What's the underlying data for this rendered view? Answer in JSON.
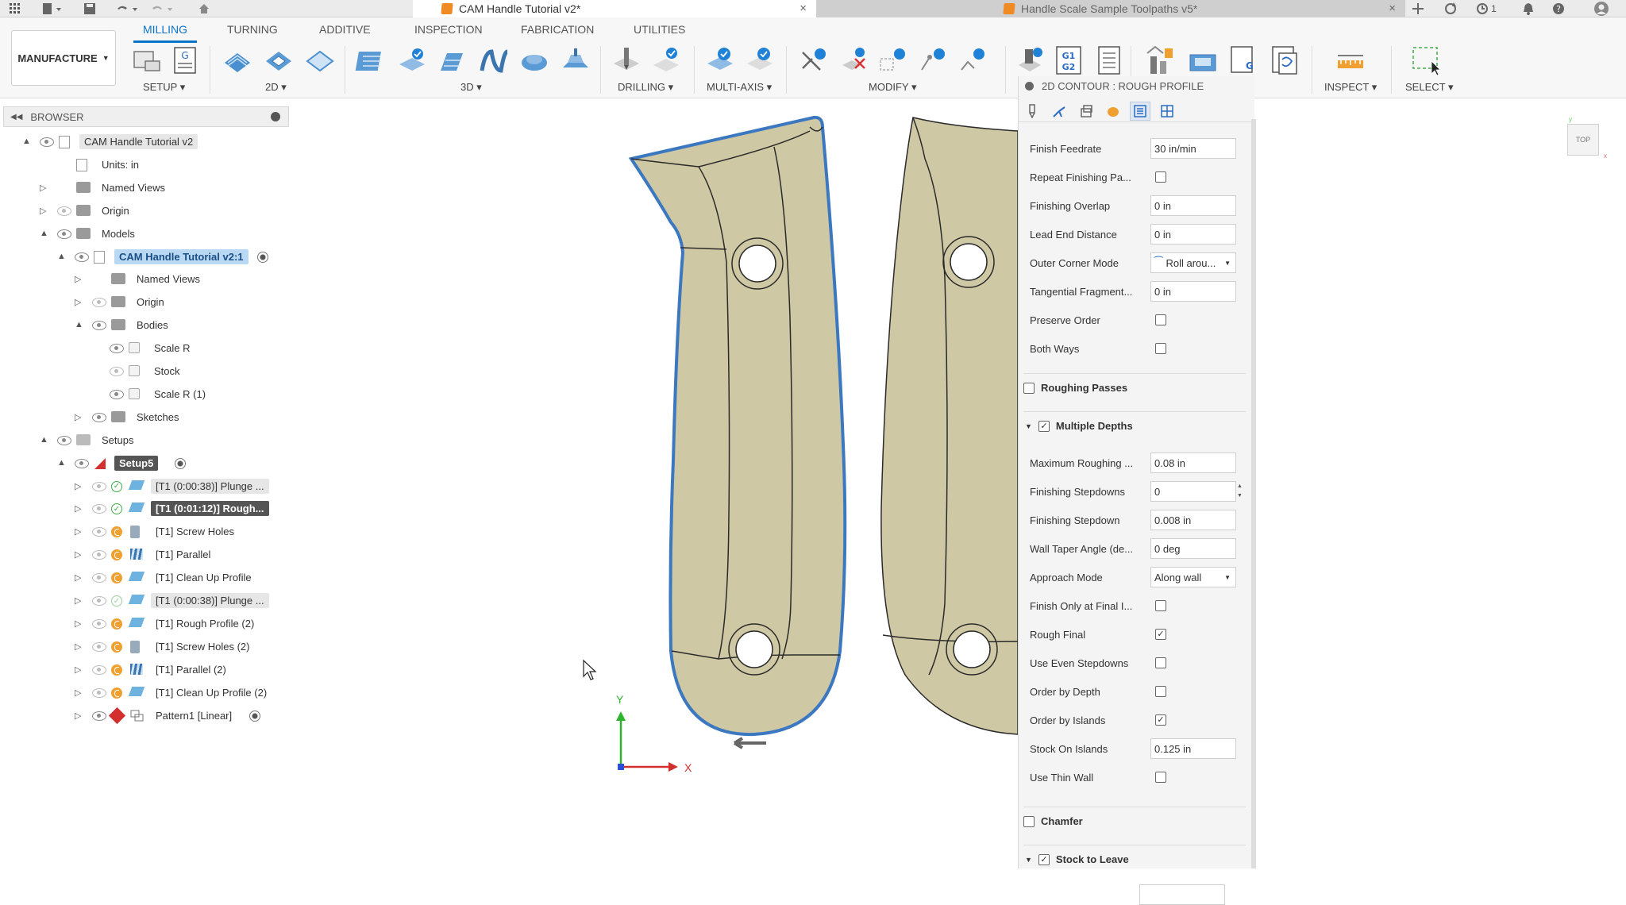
{
  "titlebar": {
    "tabs": [
      {
        "label": "CAM Handle Tutorial v2*"
      },
      {
        "label": "Handle Scale Sample Toolpaths v5*"
      }
    ],
    "notification_count": "1",
    "close_glyph": "×"
  },
  "ribbon": {
    "tabs": [
      "MILLING",
      "TURNING",
      "ADDITIVE",
      "INSPECTION",
      "FABRICATION",
      "UTILITIES"
    ],
    "workspace": "MANUFACTURE",
    "groups": [
      "SETUP",
      "2D",
      "3D",
      "DRILLING",
      "MULTI-AXIS",
      "MODIFY",
      "INSPECT",
      "SELECT"
    ]
  },
  "browser": {
    "title": "BROWSER",
    "items": [
      {
        "label": "CAM Handle Tutorial v2"
      },
      {
        "label": "Units: in"
      },
      {
        "label": "Named Views"
      },
      {
        "label": "Origin"
      },
      {
        "label": "Models"
      },
      {
        "label": "CAM Handle Tutorial v2:1"
      },
      {
        "label": "Named Views"
      },
      {
        "label": "Origin"
      },
      {
        "label": "Bodies"
      },
      {
        "label": "Scale R"
      },
      {
        "label": "Stock"
      },
      {
        "label": "Scale R (1)"
      },
      {
        "label": "Sketches"
      },
      {
        "label": "Setups"
      },
      {
        "label": "Setup5"
      },
      {
        "label": "[T1 (0:00:38)] Plunge ..."
      },
      {
        "label": "[T1 (0:01:12)] Rough..."
      },
      {
        "label": "[T1] Screw Holes"
      },
      {
        "label": "[T1] Parallel"
      },
      {
        "label": "[T1] Clean Up Profile"
      },
      {
        "label": "[T1 (0:00:38)] Plunge ..."
      },
      {
        "label": "[T1] Rough Profile (2)"
      },
      {
        "label": "[T1] Screw Holes (2)"
      },
      {
        "label": "[T1] Parallel (2)"
      },
      {
        "label": "[T1] Clean Up Profile (2)"
      },
      {
        "label": "Pattern1 [Linear]"
      }
    ]
  },
  "viewport": {
    "axis_x": "X",
    "axis_y": "Y",
    "viewcube": "TOP"
  },
  "panel": {
    "title": "2D CONTOUR : ROUGH PROFILE",
    "params": [
      {
        "label": "Finish Feedrate",
        "value": "30 in/min"
      },
      {
        "label": "Repeat Finishing Pa...",
        "checked": false
      },
      {
        "label": "Finishing Overlap",
        "value": "0 in"
      },
      {
        "label": "Lead End Distance",
        "value": "0 in"
      },
      {
        "label": "Outer Corner Mode",
        "value": "Roll arou..."
      },
      {
        "label": "Tangential Fragment...",
        "value": "0 in"
      },
      {
        "label": "Preserve Order",
        "checked": false
      },
      {
        "label": "Both Ways",
        "checked": false
      }
    ],
    "section_roughing": "Roughing Passes",
    "section_depths": "Multiple Depths",
    "depths": [
      {
        "label": "Maximum Roughing ...",
        "value": "0.08 in"
      },
      {
        "label": "Finishing Stepdowns",
        "value": "0"
      },
      {
        "label": "Finishing Stepdown",
        "value": "0.008 in"
      },
      {
        "label": "Wall Taper Angle (de...",
        "value": "0 deg"
      },
      {
        "label": "Approach Mode",
        "value": "Along wall"
      },
      {
        "label": "Finish Only at Final I...",
        "checked": false
      },
      {
        "label": "Rough Final",
        "checked": true
      },
      {
        "label": "Use Even Stepdowns",
        "checked": false
      },
      {
        "label": "Order by Depth",
        "checked": false
      },
      {
        "label": "Order by Islands",
        "checked": true
      },
      {
        "label": "Stock On Islands",
        "value": "0.125 in"
      },
      {
        "label": "Use Thin Wall",
        "checked": false
      }
    ],
    "section_chamfer": "Chamfer",
    "section_stock": "Stock to Leave",
    "check_glyph": "✓"
  },
  "colors": {
    "accent": "#0a74c9",
    "part": "#cfc8a4",
    "part_outline": "#3c78c0"
  }
}
